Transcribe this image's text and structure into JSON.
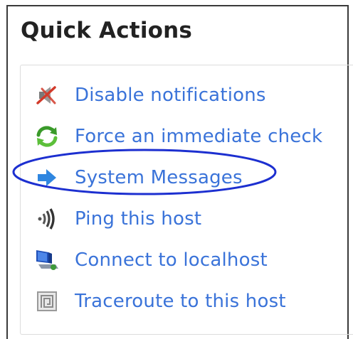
{
  "panel": {
    "title": "Quick Actions"
  },
  "actions": [
    {
      "label": "Disable notifications",
      "icon": "muted-speaker-icon"
    },
    {
      "label": "Force an immediate check",
      "icon": "refresh-arrows-icon"
    },
    {
      "label": "System Messages",
      "icon": "right-arrow-icon"
    },
    {
      "label": "Ping this host",
      "icon": "signal-waves-icon"
    },
    {
      "label": "Connect to localhost",
      "icon": "computer-monitor-icon"
    },
    {
      "label": "Traceroute to this host",
      "icon": "route-maze-icon"
    }
  ],
  "colors": {
    "link": "#3a73d9",
    "highlight_ellipse": "#1c2fd0",
    "title": "#222222"
  }
}
